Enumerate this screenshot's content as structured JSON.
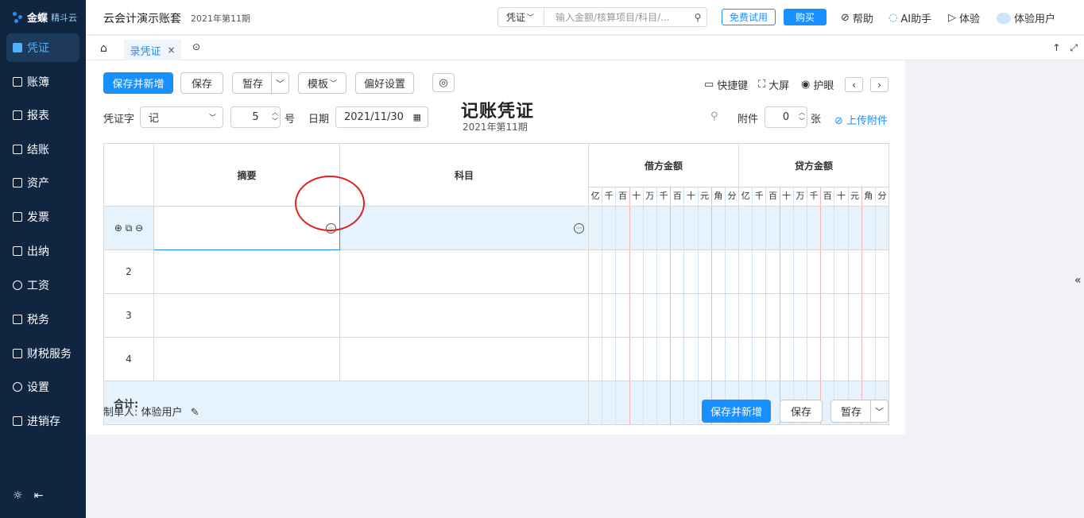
{
  "sidebar": {
    "logo_main": "金蝶",
    "logo_sub": "精斗云",
    "items": [
      {
        "label": "凭证",
        "icon": "voucher-icon"
      },
      {
        "label": "账簿",
        "icon": "ledger-icon"
      },
      {
        "label": "报表",
        "icon": "report-icon"
      },
      {
        "label": "结账",
        "icon": "closing-icon"
      },
      {
        "label": "资产",
        "icon": "asset-icon"
      },
      {
        "label": "发票",
        "icon": "invoice-icon"
      },
      {
        "label": "出纳",
        "icon": "cashier-icon"
      },
      {
        "label": "工资",
        "icon": "salary-icon"
      },
      {
        "label": "税务",
        "icon": "tax-icon"
      },
      {
        "label": "财税服务",
        "icon": "finance-service-icon"
      },
      {
        "label": "设置",
        "icon": "settings-icon"
      },
      {
        "label": "进销存",
        "icon": "inventory-icon"
      }
    ]
  },
  "topbar": {
    "account": "云会计演示账套",
    "period": "2021年第11期",
    "search_type": "凭证",
    "search_placeholder": "输入金额/核算项目/科目/...",
    "trial": "免费试用",
    "buy": "购买",
    "help": "帮助",
    "ai": "AI助手",
    "experience": "体验",
    "user": "体验用户"
  },
  "tabs": {
    "active": "录凭证"
  },
  "toolbar": {
    "save_new": "保存并新增",
    "save": "保存",
    "draft": "暂存",
    "template": "模板",
    "preference": "偏好设置",
    "shortcut": "快捷键",
    "fullscreen": "大屏",
    "eye_care": "护眼"
  },
  "form": {
    "voucher_word_label": "凭证字",
    "voucher_word": "记",
    "number": "5",
    "number_unit": "号",
    "date_label": "日期",
    "date": "2021/11/30",
    "attach_label": "附件",
    "attach_count": "0",
    "attach_unit": "张",
    "upload": "上传附件"
  },
  "voucher": {
    "title": "记账凭证",
    "period": "2021年第11期",
    "col_summary": "摘要",
    "col_subject": "科目",
    "col_debit": "借方金额",
    "col_credit": "贷方金额",
    "digits": [
      "亿",
      "千",
      "百",
      "十",
      "万",
      "千",
      "百",
      "十",
      "元",
      "角",
      "分"
    ],
    "rows": [
      "",
      "2",
      "3",
      "4"
    ],
    "total": "合计:"
  },
  "footer": {
    "maker_label": "制单人:",
    "maker": "体验用户",
    "save_new": "保存并新增",
    "save": "保存",
    "draft": "暂存"
  }
}
